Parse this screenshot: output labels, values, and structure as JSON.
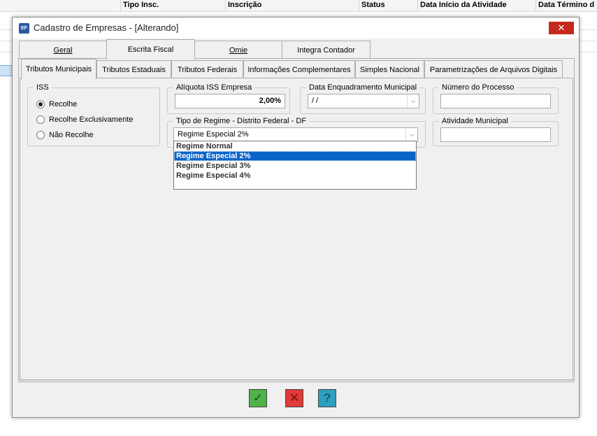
{
  "background_grid": {
    "columns": [
      "Tipo Insc.",
      "Inscrição",
      "Status",
      "Data Início da Atividade",
      "Data Término d"
    ]
  },
  "dialog": {
    "icon_label": "EF",
    "title": "Cadastro de Empresas - [Alterando]",
    "close_label": "✕"
  },
  "top_tabs": [
    "Geral",
    "Escrita Fiscal",
    "Omie",
    "Integra Contador"
  ],
  "sub_tabs": [
    "Tributos Municipais",
    "Tributos Estaduais",
    "Tributos Federais",
    "Informações Complementares",
    "Simples Nacional",
    "Parametrizações de Arquivos Digitais"
  ],
  "iss": {
    "legend": "ISS",
    "options": [
      "Recolhe",
      "Recolhe Exclusivamente",
      "Não Recolhe"
    ],
    "selected": "Recolhe"
  },
  "aliquota": {
    "legend": "Alíquota ISS Empresa",
    "value": "2,00%"
  },
  "data_enquadramento": {
    "legend": "Data Enquadramento Municipal",
    "value": " /  /"
  },
  "numero_processo": {
    "legend": "Número do Processo",
    "value": ""
  },
  "tipo_regime": {
    "legend": "Tipo de Regime - Distrito Federal - DF",
    "value": "Regime Especial 2%",
    "options": [
      "Regime Normal",
      "Regime Especial 2%",
      "Regime Especial 3%",
      "Regime Especial 4%"
    ],
    "highlighted": "Regime Especial 2%"
  },
  "atividade_municipal": {
    "legend": "Atividade Municipal",
    "value": ""
  },
  "footer": {
    "ok_icon": "check-icon",
    "cancel_icon": "x-icon",
    "help_icon": "question-icon",
    "ok_glyph": "✓",
    "cancel_glyph": "✕",
    "help_glyph": "?"
  }
}
